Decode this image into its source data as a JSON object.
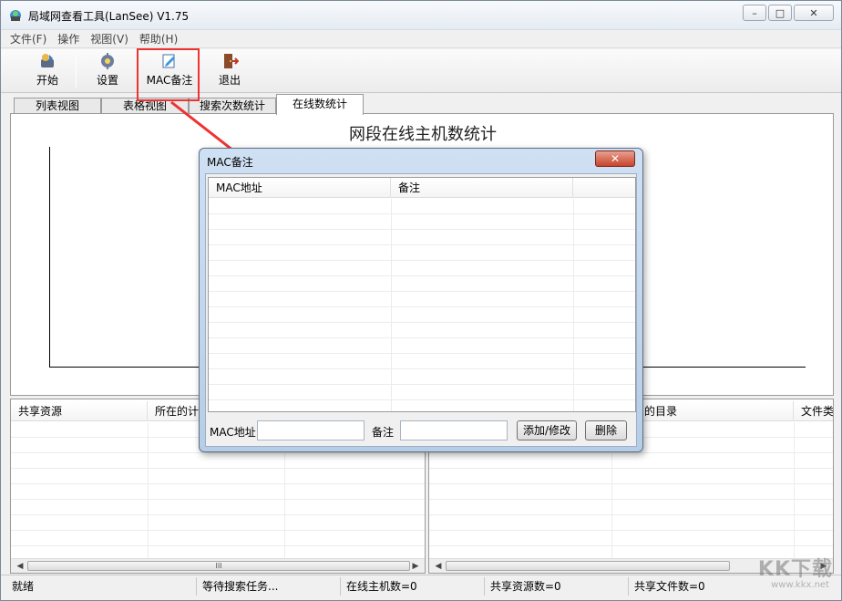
{
  "window": {
    "title": "局域网查看工具(LanSee) V1.75",
    "minimize": "▭",
    "maximize": "□",
    "close": "✕"
  },
  "menu": [
    "文件(F)",
    "操作",
    "视图(V)",
    "帮助(H)"
  ],
  "toolbar": {
    "start": "开始",
    "settings": "设置",
    "mac_note": "MAC备注",
    "exit": "退出"
  },
  "tabs": [
    "列表视图",
    "表格视图",
    "搜索次数统计",
    "在线数统计"
  ],
  "active_tab": 3,
  "chart": {
    "title": "网段在线主机数统计"
  },
  "left_panel": {
    "columns": [
      "共享资源",
      "所在的计"
    ]
  },
  "right_panel": {
    "columns": [
      "的目录",
      "文件类"
    ]
  },
  "scrollbar_thumb": "III",
  "status": {
    "ready": "就绪",
    "waiting": "等待搜索任务...",
    "online_hosts": "在线主机数=0",
    "share_count": "共享资源数=0",
    "file_count": "共享文件数=0"
  },
  "dialog": {
    "title": "MAC备注",
    "close": "✕",
    "columns": [
      "MAC地址",
      "备注"
    ],
    "mac_label": "MAC地址",
    "note_label": "备注",
    "mac_value": "",
    "note_value": "",
    "add_button": "添加/修改",
    "delete_button": "删除"
  },
  "watermark": "KK下载",
  "watermark_sub": "www.kkx.net",
  "colors": {
    "highlight": "#e33333",
    "dialog_frame": "#b7cde6"
  }
}
